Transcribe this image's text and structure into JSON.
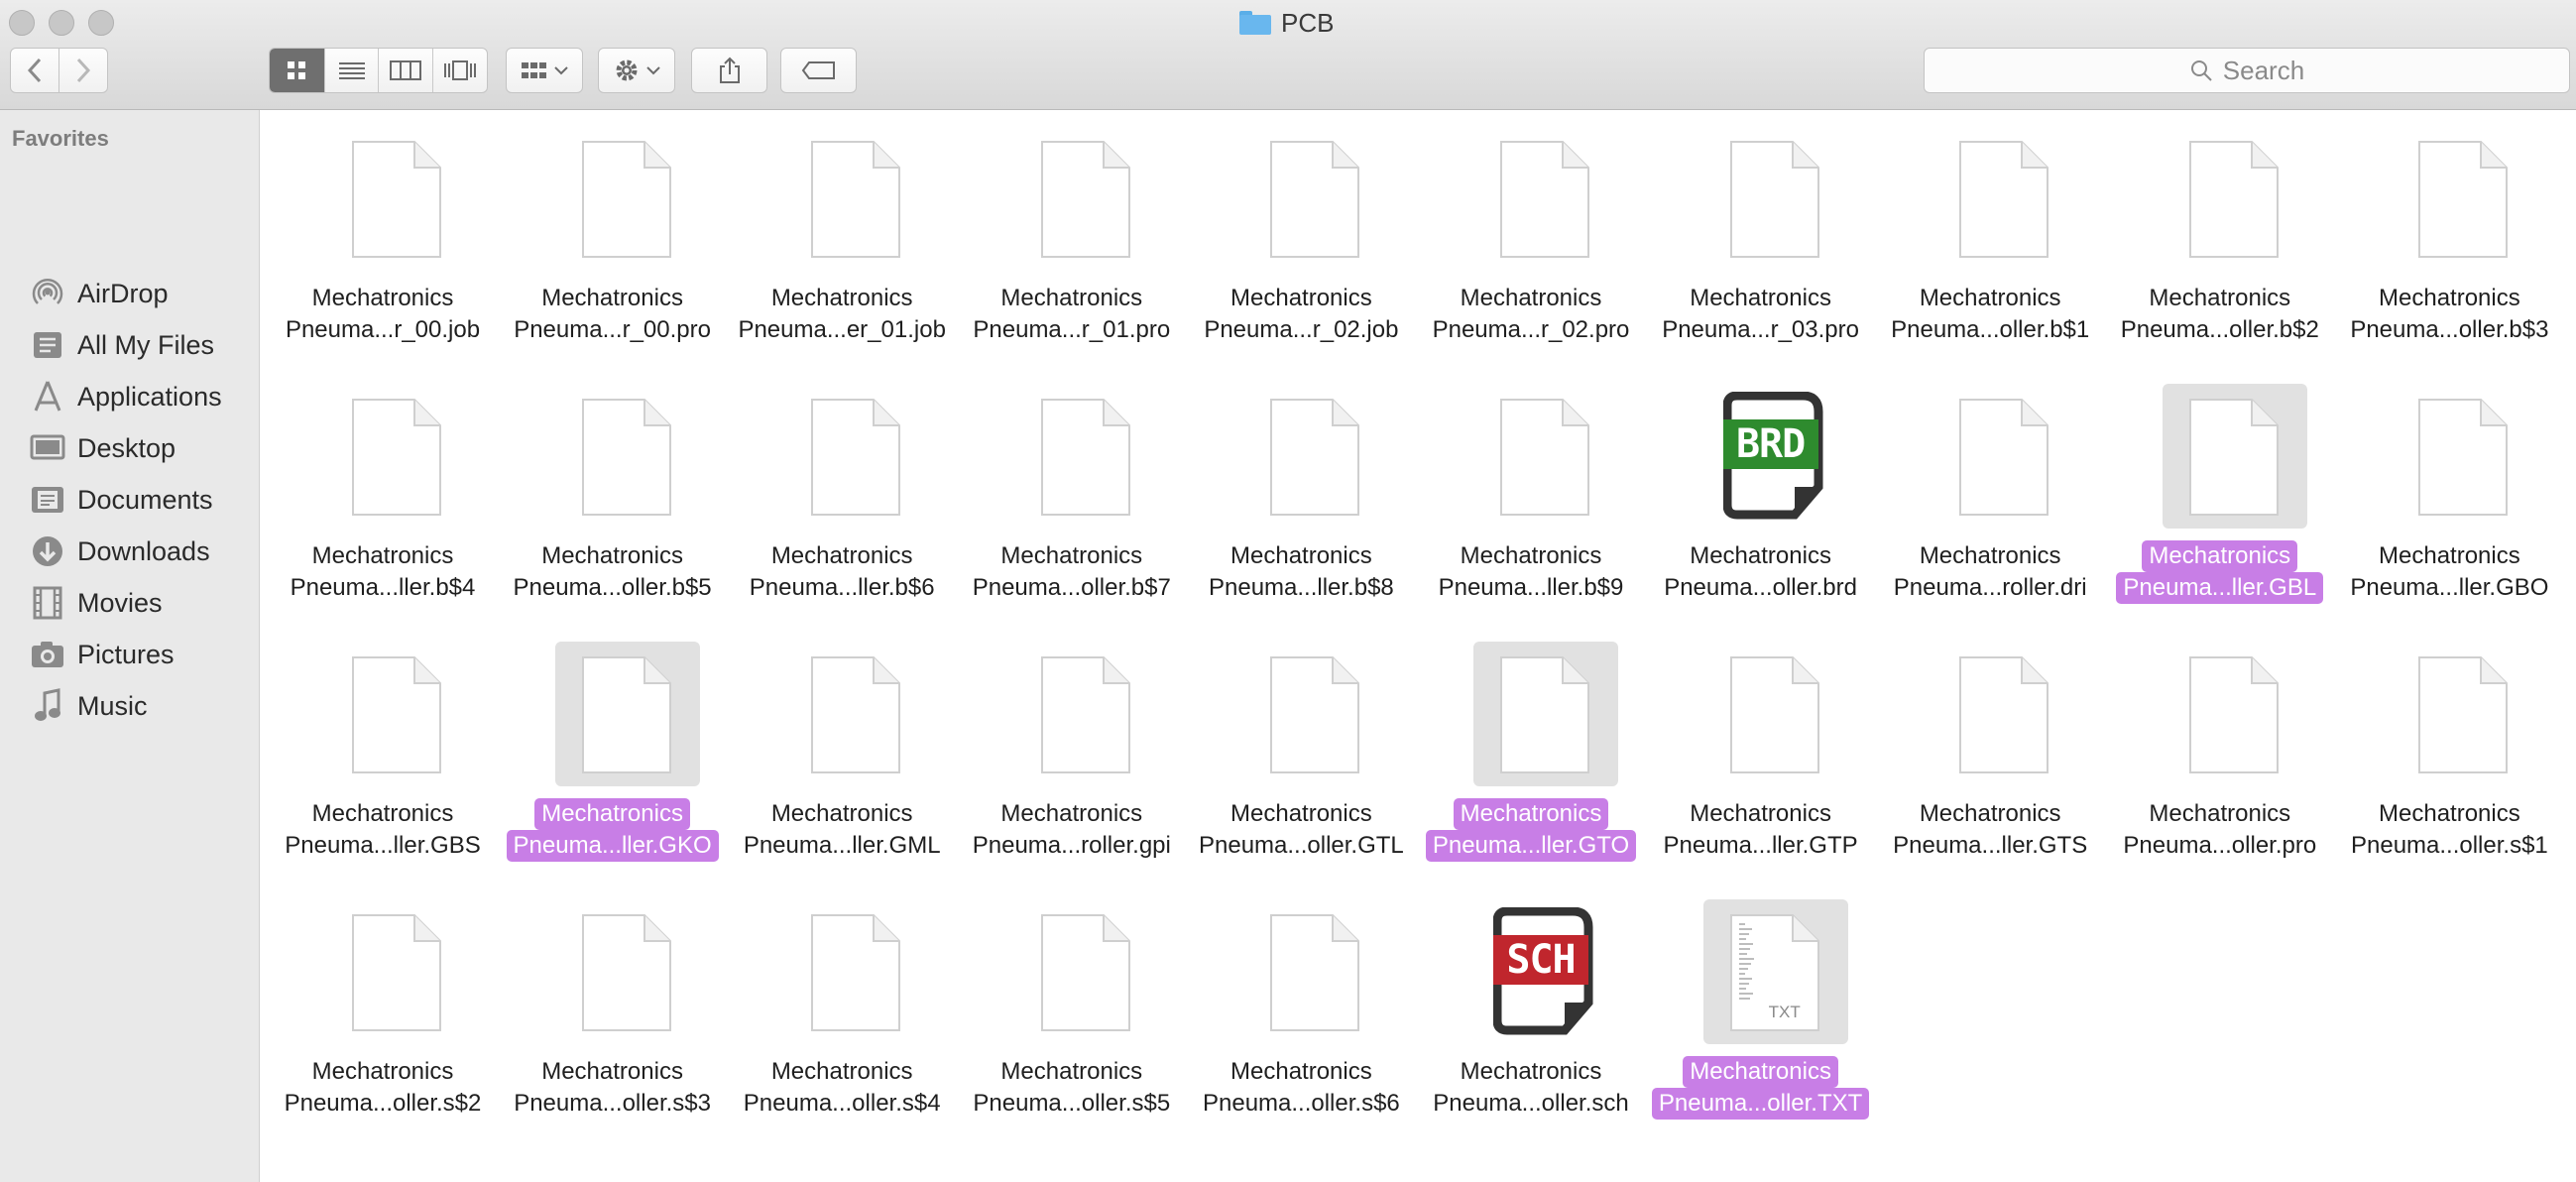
{
  "window": {
    "title": "PCB"
  },
  "toolbar": {
    "back_icon": "chevron-left-icon",
    "forward_icon": "chevron-right-icon",
    "views": [
      "icon-view-icon",
      "list-view-icon",
      "column-view-icon",
      "cover-flow-icon"
    ],
    "search_placeholder": "Search"
  },
  "sidebar": {
    "heading": "Favorites",
    "items": [
      {
        "label": "AirDrop",
        "icon": "airdrop-icon"
      },
      {
        "label": "All My Files",
        "icon": "all-files-icon"
      },
      {
        "label": "Applications",
        "icon": "applications-icon"
      },
      {
        "label": "Desktop",
        "icon": "desktop-icon"
      },
      {
        "label": "Documents",
        "icon": "documents-icon"
      },
      {
        "label": "Downloads",
        "icon": "downloads-icon"
      },
      {
        "label": "Movies",
        "icon": "movies-icon"
      },
      {
        "label": "Pictures",
        "icon": "pictures-icon"
      },
      {
        "label": "Music",
        "icon": "music-icon"
      }
    ]
  },
  "files": [
    {
      "line1": "Mechatronics",
      "line2": "Pneuma...r_00.job",
      "icon": "document-icon",
      "selected": false
    },
    {
      "line1": "Mechatronics",
      "line2": "Pneuma...r_00.pro",
      "icon": "document-icon",
      "selected": false
    },
    {
      "line1": "Mechatronics",
      "line2": "Pneuma...er_01.job",
      "icon": "document-icon",
      "selected": false
    },
    {
      "line1": "Mechatronics",
      "line2": "Pneuma...r_01.pro",
      "icon": "document-icon",
      "selected": false
    },
    {
      "line1": "Mechatronics",
      "line2": "Pneuma...r_02.job",
      "icon": "document-icon",
      "selected": false
    },
    {
      "line1": "Mechatronics",
      "line2": "Pneuma...r_02.pro",
      "icon": "document-icon",
      "selected": false
    },
    {
      "line1": "Mechatronics",
      "line2": "Pneuma...r_03.pro",
      "icon": "document-icon",
      "selected": false
    },
    {
      "line1": "Mechatronics",
      "line2": "Pneuma...oller.b$1",
      "icon": "document-icon",
      "selected": false
    },
    {
      "line1": "Mechatronics",
      "line2": "Pneuma...oller.b$2",
      "icon": "document-icon",
      "selected": false
    },
    {
      "line1": "Mechatronics",
      "line2": "Pneuma...oller.b$3",
      "icon": "document-icon",
      "selected": false
    },
    {
      "line1": "Mechatronics",
      "line2": "Pneuma...ller.b$4",
      "icon": "document-icon",
      "selected": false
    },
    {
      "line1": "Mechatronics",
      "line2": "Pneuma...oller.b$5",
      "icon": "document-icon",
      "selected": false
    },
    {
      "line1": "Mechatronics",
      "line2": "Pneuma...ller.b$6",
      "icon": "document-icon",
      "selected": false
    },
    {
      "line1": "Mechatronics",
      "line2": "Pneuma...oller.b$7",
      "icon": "document-icon",
      "selected": false
    },
    {
      "line1": "Mechatronics",
      "line2": "Pneuma...ller.b$8",
      "icon": "document-icon",
      "selected": false
    },
    {
      "line1": "Mechatronics",
      "line2": "Pneuma...ller.b$9",
      "icon": "document-icon",
      "selected": false
    },
    {
      "line1": "Mechatronics",
      "line2": "Pneuma...oller.brd",
      "icon": "brd-file-icon",
      "badge": "BRD",
      "badge_color": "#2e8b2e",
      "selected": false
    },
    {
      "line1": "Mechatronics",
      "line2": "Pneuma...roller.dri",
      "icon": "document-icon",
      "selected": false
    },
    {
      "line1": "Mechatronics",
      "line2": "Pneuma...ller.GBL",
      "icon": "document-icon",
      "selected": true
    },
    {
      "line1": "Mechatronics",
      "line2": "Pneuma...ller.GBO",
      "icon": "document-icon",
      "selected": false
    },
    {
      "line1": "Mechatronics",
      "line2": "Pneuma...ller.GBS",
      "icon": "document-icon",
      "selected": false
    },
    {
      "line1": "Mechatronics",
      "line2": "Pneuma...ller.GKO",
      "icon": "document-icon",
      "selected": true
    },
    {
      "line1": "Mechatronics",
      "line2": "Pneuma...ller.GML",
      "icon": "document-icon",
      "selected": false
    },
    {
      "line1": "Mechatronics",
      "line2": "Pneuma...roller.gpi",
      "icon": "document-icon",
      "selected": false
    },
    {
      "line1": "Mechatronics",
      "line2": "Pneuma...oller.GTL",
      "icon": "document-icon",
      "selected": false
    },
    {
      "line1": "Mechatronics",
      "line2": "Pneuma...ller.GTO",
      "icon": "document-icon",
      "selected": true
    },
    {
      "line1": "Mechatronics",
      "line2": "Pneuma...ller.GTP",
      "icon": "document-icon",
      "selected": false
    },
    {
      "line1": "Mechatronics",
      "line2": "Pneuma...ller.GTS",
      "icon": "document-icon",
      "selected": false
    },
    {
      "line1": "Mechatronics",
      "line2": "Pneuma...oller.pro",
      "icon": "document-icon",
      "selected": false
    },
    {
      "line1": "Mechatronics",
      "line2": "Pneuma...oller.s$1",
      "icon": "document-icon",
      "selected": false
    },
    {
      "line1": "Mechatronics",
      "line2": "Pneuma...oller.s$2",
      "icon": "document-icon",
      "selected": false
    },
    {
      "line1": "Mechatronics",
      "line2": "Pneuma...oller.s$3",
      "icon": "document-icon",
      "selected": false
    },
    {
      "line1": "Mechatronics",
      "line2": "Pneuma...oller.s$4",
      "icon": "document-icon",
      "selected": false
    },
    {
      "line1": "Mechatronics",
      "line2": "Pneuma...oller.s$5",
      "icon": "document-icon",
      "selected": false
    },
    {
      "line1": "Mechatronics",
      "line2": "Pneuma...oller.s$6",
      "icon": "document-icon",
      "selected": false
    },
    {
      "line1": "Mechatronics",
      "line2": "Pneuma...oller.sch",
      "icon": "sch-file-icon",
      "badge": "SCH",
      "badge_color": "#c0262d",
      "selected": false
    },
    {
      "line1": "Mechatronics",
      "line2": "Pneuma...oller.TXT",
      "icon": "txt-file-icon",
      "badge": "TXT",
      "selected": true
    }
  ],
  "colors": {
    "selection": "#c87ee6",
    "selected_thumb": "#e1e1e1",
    "sidebar_bg": "#e9e9e9"
  }
}
